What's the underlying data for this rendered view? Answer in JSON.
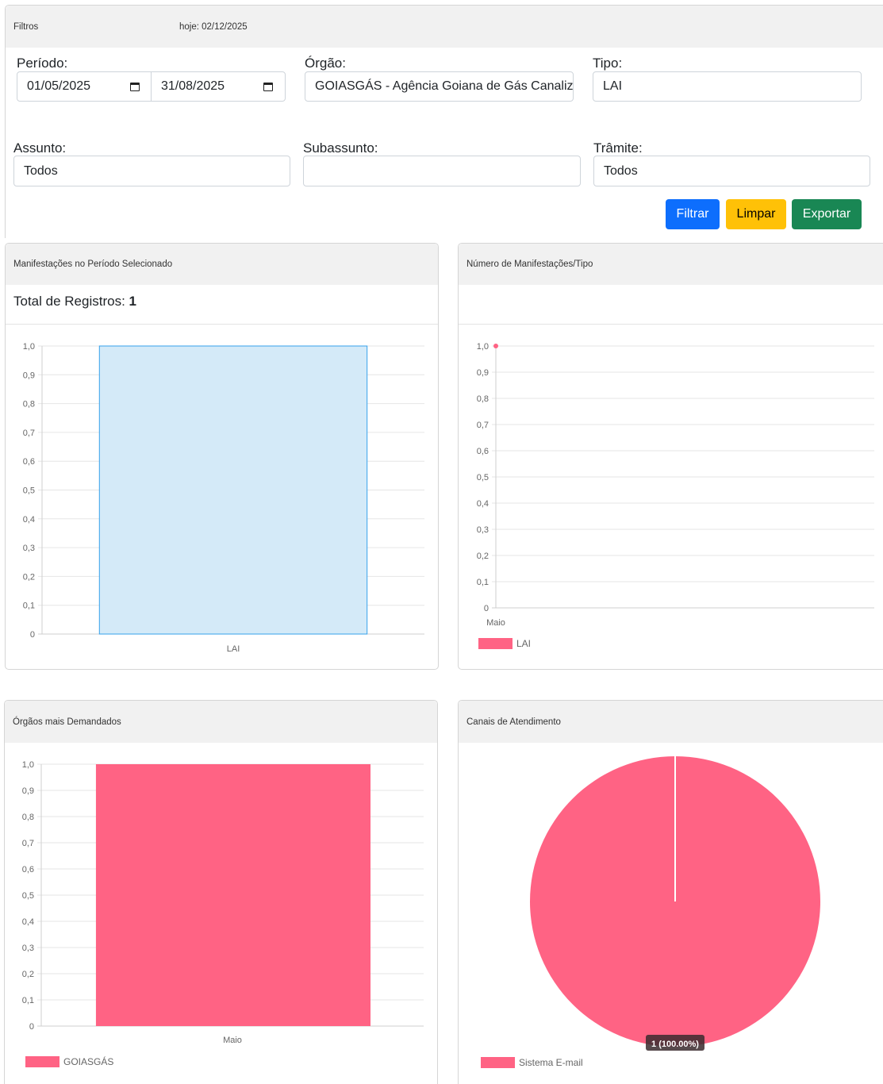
{
  "filters": {
    "title": "Filtros",
    "today": "hoje: 02/12/2025",
    "periodo_label": "Período:",
    "date_start": "01/05/2025",
    "date_end": "31/08/2025",
    "orgao_label": "Órgão:",
    "orgao_value": "GOIASGÁS - Agência Goiana de Gás Canalizado",
    "tipo_label": "Tipo:",
    "tipo_value": "LAI",
    "assunto_label": "Assunto:",
    "assunto_value": "Todos",
    "subassunto_label": "Subassunto:",
    "subassunto_value": "",
    "tramite_label": "Trâmite:",
    "tramite_value": "Todos",
    "filtrar": "Filtrar",
    "limpar": "Limpar",
    "exportar": "Exportar"
  },
  "panels": {
    "manifestacoes": {
      "title": "Manifestações no Período Selecionado",
      "total_label": "Total de Registros: ",
      "total_value": "1"
    },
    "por_tipo": {
      "title": "Número de Manifestações/Tipo"
    },
    "orgaos": {
      "title": "Órgãos mais Demandados"
    },
    "canais": {
      "title": "Canais de Atendimento"
    }
  },
  "colors": {
    "primary": "#0d6efd",
    "warning": "#ffc107",
    "success": "#198754",
    "pink": "#ff6384",
    "blue_fill": "#d4eaf8",
    "blue_line": "#36a2eb"
  },
  "chart_data": [
    {
      "type": "bar",
      "categories": [
        "LAI"
      ],
      "values": [
        1
      ],
      "yticks": [
        "0",
        "0,1",
        "0,2",
        "0,3",
        "0,4",
        "0,5",
        "0,6",
        "0,7",
        "0,8",
        "0,9",
        "1,0"
      ],
      "ylim": [
        0,
        1
      ],
      "grid": true
    },
    {
      "type": "line",
      "categories": [
        "Maio"
      ],
      "series": [
        {
          "name": "LAI",
          "values": [
            1
          ]
        }
      ],
      "yticks": [
        "0",
        "0,1",
        "0,2",
        "0,3",
        "0,4",
        "0,5",
        "0,6",
        "0,7",
        "0,8",
        "0,9",
        "1,0"
      ],
      "ylim": [
        0,
        1
      ],
      "legend": "bottom-left",
      "grid": true
    },
    {
      "type": "bar",
      "categories": [
        "Maio"
      ],
      "series": [
        {
          "name": "GOIASGÁS",
          "values": [
            1
          ]
        }
      ],
      "yticks": [
        "0",
        "0,1",
        "0,2",
        "0,3",
        "0,4",
        "0,5",
        "0,6",
        "0,7",
        "0,8",
        "0,9",
        "1,0"
      ],
      "ylim": [
        0,
        1
      ],
      "legend": "bottom-left",
      "grid": true
    },
    {
      "type": "pie",
      "categories": [
        "Sistema E-mail"
      ],
      "values": [
        1
      ],
      "data_labels": [
        "1 (100.00%)"
      ],
      "legend": "bottom-left"
    }
  ]
}
